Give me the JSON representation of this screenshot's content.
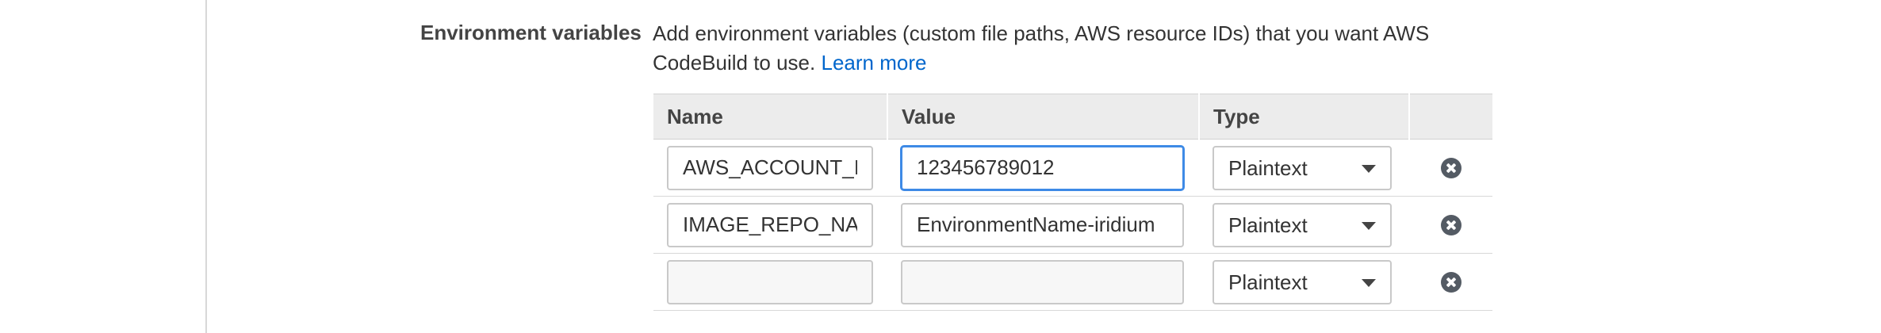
{
  "section": {
    "label": "Environment variables",
    "description": "Add environment variables (custom file paths, AWS resource IDs) that you want AWS CodeBuild to use.",
    "learn_more": "Learn more"
  },
  "table": {
    "headers": {
      "name": "Name",
      "value": "Value",
      "type": "Type",
      "remove": ""
    },
    "rows": [
      {
        "name": "AWS_ACCOUNT_ID",
        "value": "123456789012",
        "type": "Plaintext"
      },
      {
        "name": "IMAGE_REPO_NAME",
        "value": "EnvironmentName-iridium",
        "type": "Plaintext"
      },
      {
        "name": "",
        "value": "",
        "type": "Plaintext"
      }
    ]
  },
  "icons": {
    "remove": "remove-circle-x-icon",
    "dropdown": "chevron-down-icon"
  },
  "colors": {
    "link": "#0066cc",
    "focus": "#3e8ae6",
    "header_bg": "#ececec"
  }
}
